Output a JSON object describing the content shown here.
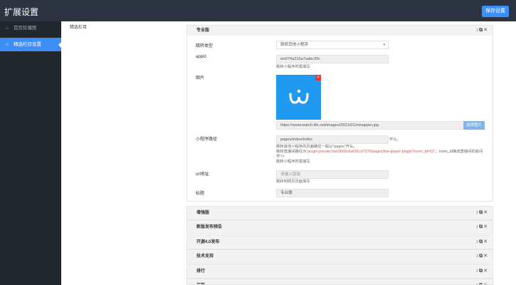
{
  "header": {
    "title": "扩展设置",
    "save_label": "保存设置"
  },
  "sidebar": {
    "items": [
      {
        "label": "首页轮播图",
        "icon": "home-icon",
        "active": false
      },
      {
        "label": "精选栏目设置",
        "icon": "home-icon",
        "active": true
      }
    ]
  },
  "breadcrumb": "精选栏目",
  "main_panel": {
    "title": "专业版",
    "tools": "↕⧉✕",
    "fields": {
      "jump_type": {
        "label": "跳转类型",
        "value": "跳转其他小程序"
      },
      "appid": {
        "label": "appid",
        "value": "wx074a216a7aabc30c",
        "hint": "跳转小程序时需填写"
      },
      "image": {
        "label": "图片",
        "url": "https://www.watch-life.net/images/2021/01/minapper.jpg",
        "button": "选择图片",
        "close": "×"
      },
      "mp_path": {
        "label": "小程序路径",
        "value": "pages/index/index",
        "suffix": "开头。",
        "hint1": "跳转其他小程序的页面路径一般以\"pages\"开头。",
        "hint2_prefix": "跳转直播间路径为",
        "hint2_red": "\"plugin-private://wx2b03c6e691cd7370/pages/live-player-plugin?room_id=11\"",
        "hint2_suffix": "，room_id换成直播间的房间",
        "hint3": "号\"/>",
        "hint4": "跳转小程序时需填写"
      },
      "url": {
        "label": "url地址",
        "placeholder": "请输入链接",
        "hint": "跳转到网页页面填写"
      },
      "title": {
        "label": "标题",
        "value": "专业版"
      }
    }
  },
  "sub_panels": [
    {
      "title": "增强版",
      "tools": "↕⧉✕"
    },
    {
      "title": "新版发布预告",
      "tools": "↕⧉✕"
    },
    {
      "title": "开源4.0发布",
      "tools": "↕⧉✕"
    },
    {
      "title": "技术支持",
      "tools": "↕⧉✕"
    },
    {
      "title": "排行",
      "tools": "↕⧉✕"
    },
    {
      "title": "文档",
      "tools": "↕⧉✕"
    }
  ],
  "colors": {
    "header": "#2b3440",
    "sidebar": "#22272e",
    "accent": "#3e8ef7",
    "thumb": "#1f9af0"
  }
}
